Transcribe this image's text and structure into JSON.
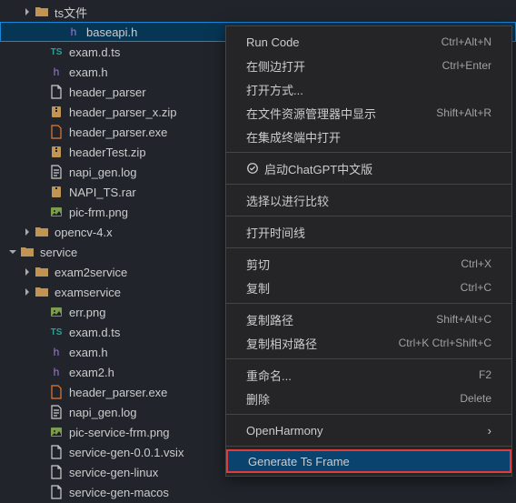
{
  "tree": {
    "items": [
      {
        "indent": 24,
        "chevron": "right",
        "icon": "folder",
        "label": "ts文件"
      },
      {
        "indent": 58,
        "chevron": "",
        "icon": "h",
        "label": "baseapi.h",
        "selected": true
      },
      {
        "indent": 40,
        "chevron": "",
        "icon": "ts",
        "label": "exam.d.ts"
      },
      {
        "indent": 40,
        "chevron": "",
        "icon": "h",
        "label": "exam.h"
      },
      {
        "indent": 40,
        "chevron": "",
        "icon": "file",
        "label": "header_parser"
      },
      {
        "indent": 40,
        "chevron": "",
        "icon": "zip",
        "label": "header_parser_x.zip"
      },
      {
        "indent": 40,
        "chevron": "",
        "icon": "exe",
        "label": "header_parser.exe"
      },
      {
        "indent": 40,
        "chevron": "",
        "icon": "zip",
        "label": "headerTest.zip"
      },
      {
        "indent": 40,
        "chevron": "",
        "icon": "log",
        "label": "napi_gen.log"
      },
      {
        "indent": 40,
        "chevron": "",
        "icon": "rar",
        "label": "NAPI_TS.rar"
      },
      {
        "indent": 40,
        "chevron": "",
        "icon": "png",
        "label": "pic-frm.png"
      },
      {
        "indent": 24,
        "chevron": "right",
        "icon": "folder",
        "label": "opencv-4.x"
      },
      {
        "indent": 8,
        "chevron": "down",
        "icon": "folder",
        "label": "service"
      },
      {
        "indent": 24,
        "chevron": "right",
        "icon": "folder",
        "label": "exam2service"
      },
      {
        "indent": 24,
        "chevron": "right",
        "icon": "folder",
        "label": "examservice"
      },
      {
        "indent": 40,
        "chevron": "",
        "icon": "png",
        "label": "err.png"
      },
      {
        "indent": 40,
        "chevron": "",
        "icon": "ts",
        "label": "exam.d.ts"
      },
      {
        "indent": 40,
        "chevron": "",
        "icon": "h",
        "label": "exam.h"
      },
      {
        "indent": 40,
        "chevron": "",
        "icon": "h",
        "label": "exam2.h"
      },
      {
        "indent": 40,
        "chevron": "",
        "icon": "exe",
        "label": "header_parser.exe"
      },
      {
        "indent": 40,
        "chevron": "",
        "icon": "log",
        "label": "napi_gen.log"
      },
      {
        "indent": 40,
        "chevron": "",
        "icon": "png",
        "label": "pic-service-frm.png"
      },
      {
        "indent": 40,
        "chevron": "",
        "icon": "file",
        "label": "service-gen-0.0.1.vsix"
      },
      {
        "indent": 40,
        "chevron": "",
        "icon": "file",
        "label": "service-gen-linux"
      },
      {
        "indent": 40,
        "chevron": "",
        "icon": "file",
        "label": "service-gen-macos"
      }
    ]
  },
  "menu": {
    "items": [
      {
        "type": "item",
        "label": "Run Code",
        "shortcut": "Ctrl+Alt+N"
      },
      {
        "type": "item",
        "label": "在侧边打开",
        "shortcut": "Ctrl+Enter"
      },
      {
        "type": "item",
        "label": "打开方式...",
        "shortcut": ""
      },
      {
        "type": "item",
        "label": "在文件资源管理器中显示",
        "shortcut": "Shift+Alt+R"
      },
      {
        "type": "item",
        "label": "在集成终端中打开",
        "shortcut": ""
      },
      {
        "type": "sep"
      },
      {
        "type": "item",
        "label": "启动ChatGPT中文版",
        "shortcut": "",
        "chatgpt": true
      },
      {
        "type": "sep"
      },
      {
        "type": "item",
        "label": "选择以进行比较",
        "shortcut": ""
      },
      {
        "type": "sep"
      },
      {
        "type": "item",
        "label": "打开时间线",
        "shortcut": ""
      },
      {
        "type": "sep"
      },
      {
        "type": "item",
        "label": "剪切",
        "shortcut": "Ctrl+X"
      },
      {
        "type": "item",
        "label": "复制",
        "shortcut": "Ctrl+C"
      },
      {
        "type": "sep"
      },
      {
        "type": "item",
        "label": "复制路径",
        "shortcut": "Shift+Alt+C"
      },
      {
        "type": "item",
        "label": "复制相对路径",
        "shortcut": "Ctrl+K Ctrl+Shift+C"
      },
      {
        "type": "sep"
      },
      {
        "type": "item",
        "label": "重命名...",
        "shortcut": "F2"
      },
      {
        "type": "item",
        "label": "删除",
        "shortcut": "Delete"
      },
      {
        "type": "sep"
      },
      {
        "type": "item",
        "label": "OpenHarmony",
        "shortcut": "",
        "arrow": true
      },
      {
        "type": "sep"
      },
      {
        "type": "item",
        "label": "Generate Ts Frame",
        "shortcut": "",
        "highlighted": true
      }
    ]
  }
}
